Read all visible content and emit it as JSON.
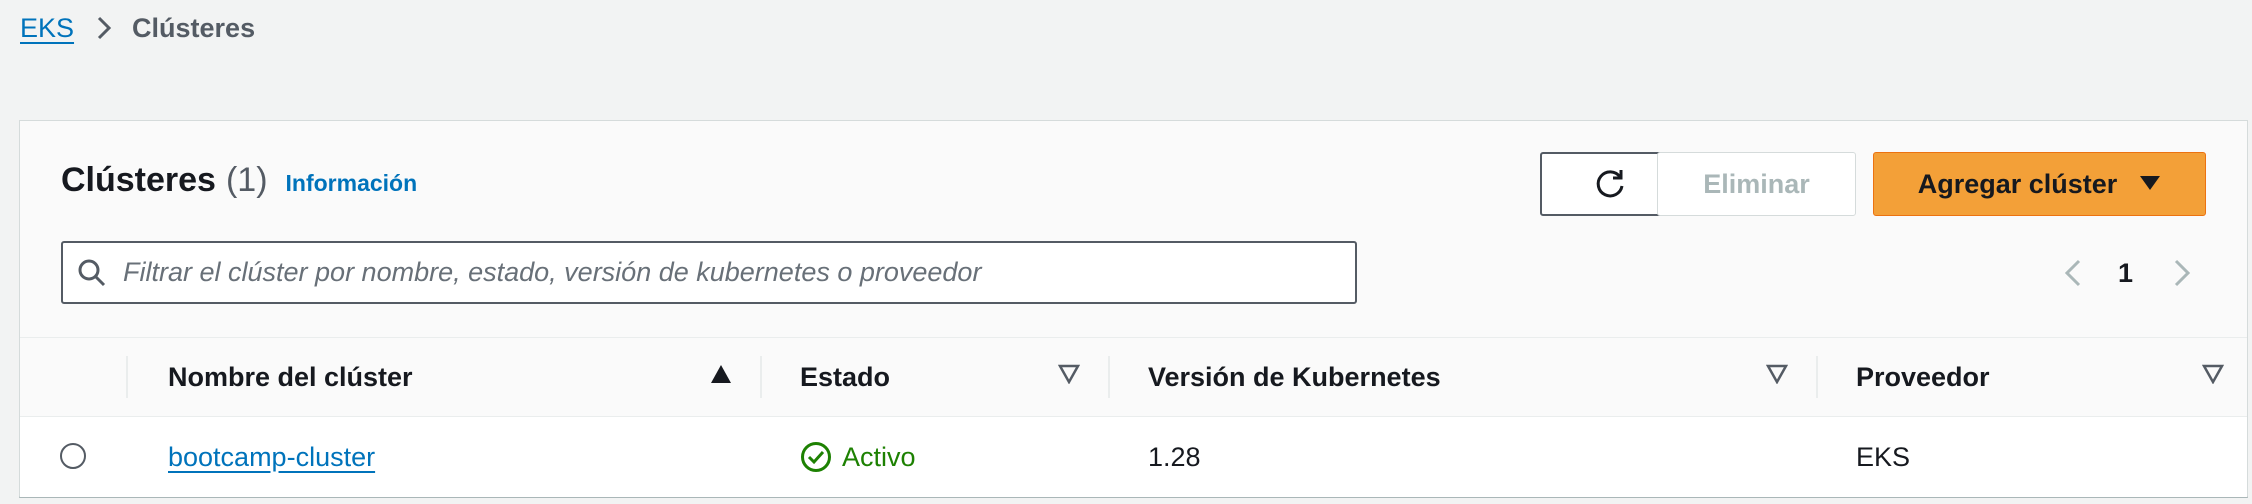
{
  "breadcrumb": {
    "root": "EKS",
    "current": "Clústeres"
  },
  "panel": {
    "title": "Clústeres",
    "count": "(1)",
    "info_link": "Información"
  },
  "toolbar": {
    "refresh_icon": "refresh-icon",
    "delete_label": "Eliminar",
    "add_label": "Agregar clúster"
  },
  "search": {
    "placeholder": "Filtrar el clúster por nombre, estado, versión de kubernetes o proveedor",
    "value": ""
  },
  "pagination": {
    "current_page": "1"
  },
  "table": {
    "columns": [
      {
        "label": "Nombre del clúster",
        "sort": "ascending"
      },
      {
        "label": "Estado",
        "sort": "none"
      },
      {
        "label": "Versión de Kubernetes",
        "sort": "none"
      },
      {
        "label": "Proveedor",
        "sort": "none"
      }
    ],
    "rows": [
      {
        "name": "bootcamp-cluster",
        "status": "Activo",
        "version": "1.28",
        "provider": "EKS",
        "selected": false
      }
    ]
  },
  "colors": {
    "link": "#0073bb",
    "primary_button": "#f3a038",
    "status_active": "#1d8102",
    "disabled_text": "#aab7b8"
  }
}
